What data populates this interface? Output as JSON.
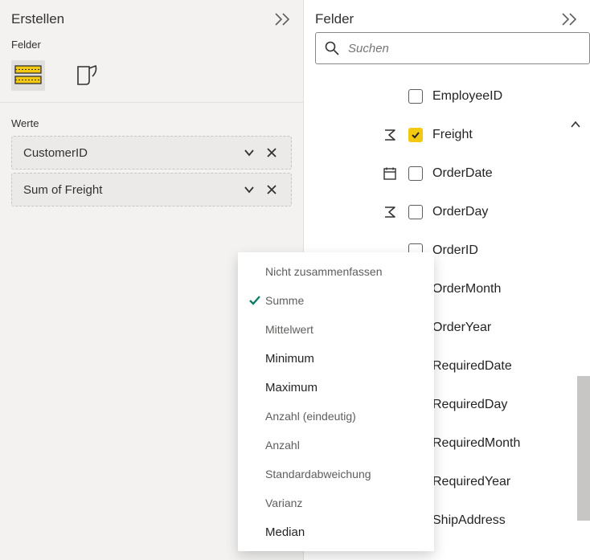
{
  "left": {
    "title": "Erstellen",
    "subheader": "Felder",
    "section": "Werte",
    "wells": [
      {
        "label": "CustomerID"
      },
      {
        "label": "Sum of Freight"
      }
    ]
  },
  "dropdown": {
    "items": [
      {
        "label": "Nicht zusammenfassen",
        "checked": false,
        "strong": false
      },
      {
        "label": "Summe",
        "checked": true,
        "strong": false
      },
      {
        "label": "Mittelwert",
        "checked": false,
        "strong": false
      },
      {
        "label": "Minimum",
        "checked": false,
        "strong": true
      },
      {
        "label": "Maximum",
        "checked": false,
        "strong": true
      },
      {
        "label": "Anzahl (eindeutig)",
        "checked": false,
        "strong": false
      },
      {
        "label": "Anzahl",
        "checked": false,
        "strong": false
      },
      {
        "label": "Standardabweichung",
        "checked": false,
        "strong": false
      },
      {
        "label": "Varianz",
        "checked": false,
        "strong": false
      },
      {
        "label": "Median",
        "checked": false,
        "strong": true
      }
    ]
  },
  "right": {
    "title": "Felder",
    "search_placeholder": "Suchen",
    "fields": [
      {
        "name": "EmployeeID",
        "type": "none",
        "checked": false
      },
      {
        "name": "Freight",
        "type": "sigma",
        "checked": true
      },
      {
        "name": "OrderDate",
        "type": "date",
        "checked": false
      },
      {
        "name": "OrderDay",
        "type": "sigma",
        "checked": false
      },
      {
        "name": "OrderID",
        "type": "none",
        "checked": false
      },
      {
        "name": "OrderMonth",
        "type": "none",
        "checked": false
      },
      {
        "name": "OrderYear",
        "type": "none",
        "checked": false
      },
      {
        "name": "RequiredDate",
        "type": "none",
        "checked": false
      },
      {
        "name": "RequiredDay",
        "type": "none",
        "checked": false
      },
      {
        "name": "RequiredMonth",
        "type": "none",
        "checked": false
      },
      {
        "name": "RequiredYear",
        "type": "none",
        "checked": false
      },
      {
        "name": "ShipAddress",
        "type": "none",
        "checked": false
      }
    ]
  },
  "icons": {
    "check_glyph": "✓"
  }
}
